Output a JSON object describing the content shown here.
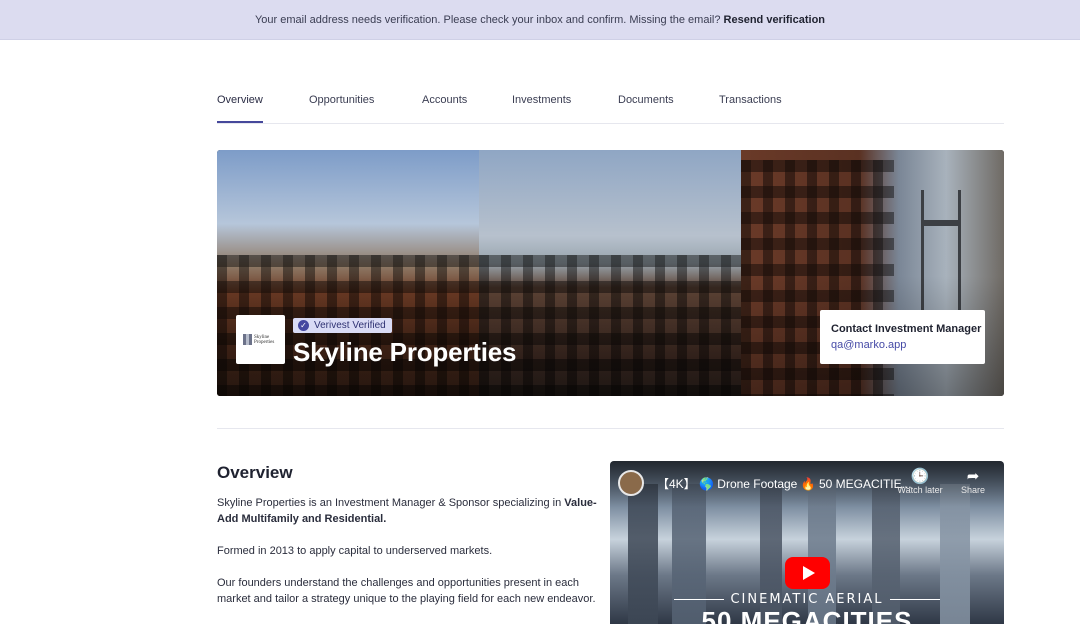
{
  "banner": {
    "message": "Your email address needs verification. Please check your inbox and confirm. Missing the email?",
    "action": "Resend verification"
  },
  "tabs": [
    {
      "label": "Overview",
      "active": true
    },
    {
      "label": "Opportunities",
      "active": false
    },
    {
      "label": "Accounts",
      "active": false
    },
    {
      "label": "Investments",
      "active": false
    },
    {
      "label": "Documents",
      "active": false
    },
    {
      "label": "Transactions",
      "active": false
    }
  ],
  "hero": {
    "logo_text": "Skyline Properties",
    "badge": "Verivest Verified",
    "company_name": "Skyline Properties",
    "contact": {
      "title": "Contact Investment Manager",
      "email": "qa@marko.app"
    }
  },
  "overview": {
    "title": "Overview",
    "intro": "Skyline Properties is an Investment Manager & Sponsor specializing in",
    "intro_bold": "Value-Add Multifamily and Residential.",
    "p2": "Formed in 2013 to apply capital to underserved markets.",
    "p3": "Our founders understand the challenges and opportunities present in each market and tailor a strategy unique to the playing field for each new endeavor."
  },
  "video": {
    "title": "【4K】 🌎 Drone Footage 🔥 50 MEGACITIE...",
    "watch_later": "Watch later",
    "share": "Share",
    "overlay_sub": "CINEMATIC AERIAL",
    "overlay_big": "50 MEGACITIES"
  },
  "colors": {
    "banner_bg": "#dcdcf0",
    "accent": "#46489b",
    "link": "#454aa6",
    "badge_bg": "#d9dbf5"
  }
}
